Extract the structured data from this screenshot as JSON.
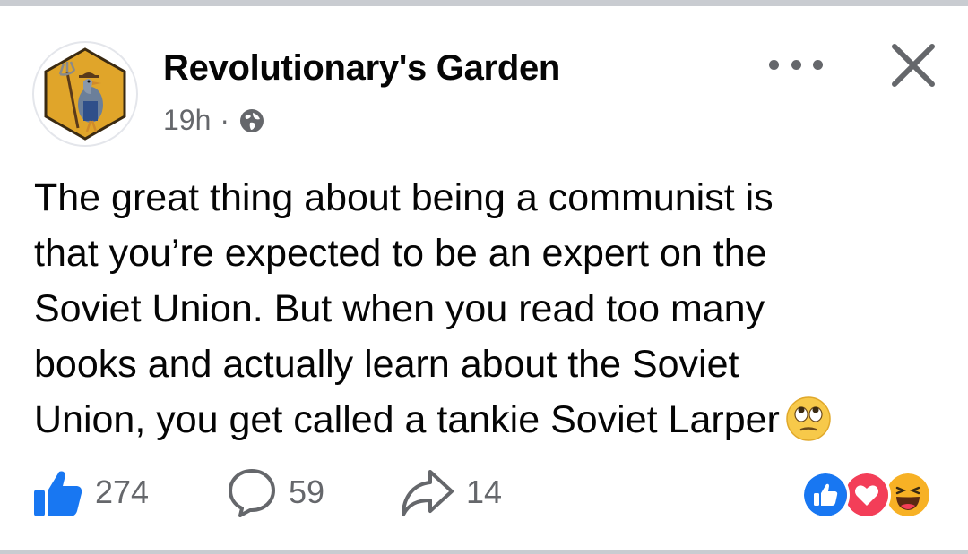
{
  "post": {
    "page_name": "Revolutionary's Garden",
    "time": "19h",
    "separator": "·",
    "privacy_icon": "globe-icon",
    "text_lines": [
      "The great thing about being a communist is",
      "that you’re expected to be an expert on the",
      "Soviet Union. But when you read too many",
      "books and actually learn about the Soviet",
      "Union, you get called a tankie Soviet Larper"
    ],
    "trailing_emoji": "face-with-rolling-eyes"
  },
  "actions": {
    "likes": "274",
    "comments": "59",
    "shares": "14"
  },
  "reactions": [
    "like",
    "love",
    "haha"
  ],
  "colors": {
    "like_blue": "#1877f2",
    "love_red": "#f33e58",
    "haha_yellow": "#f7b125",
    "secondary_text": "#65676b",
    "avatar_gold": "#e0a52a"
  }
}
